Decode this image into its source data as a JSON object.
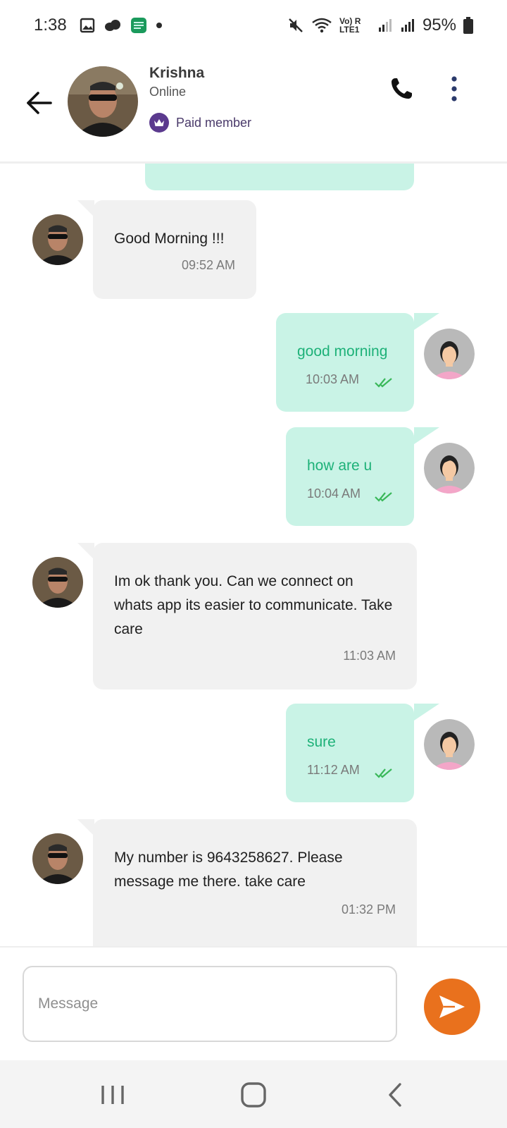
{
  "status_bar": {
    "time": "1:38",
    "battery": "95%",
    "network": "Vo) R LTE1",
    "icons": [
      "gallery-icon",
      "cloud-icon",
      "app-icon",
      "dot-icon",
      "mute-icon",
      "wifi-icon",
      "signal-icon",
      "battery-icon"
    ]
  },
  "header": {
    "name": "Krishna",
    "status": "Online",
    "membership": "Paid member",
    "accent": "#5b3a8e"
  },
  "messages": [
    {
      "direction": "in",
      "text": "Good Morning !!!",
      "time": "09:52 AM"
    },
    {
      "direction": "out",
      "text": "good morning",
      "time": "10:03 AM",
      "read": true
    },
    {
      "direction": "out",
      "text": "how are u",
      "time": "10:04 AM",
      "read": true
    },
    {
      "direction": "in",
      "text": "Im ok thank you. Can we connect on whats app its easier to communicate. Take care",
      "time": "11:03 AM"
    },
    {
      "direction": "out",
      "text": "sure",
      "time": "11:12 AM",
      "read": true
    },
    {
      "direction": "in",
      "text": "My number is 9643258627. Please message me there. take care",
      "time": "01:32 PM"
    }
  ],
  "composer": {
    "placeholder": "Message",
    "send_color": "#e9711d"
  },
  "colors": {
    "incoming_bubble": "#f1f1f1",
    "outgoing_bubble": "#c9f3e6",
    "outgoing_text": "#1db178"
  }
}
